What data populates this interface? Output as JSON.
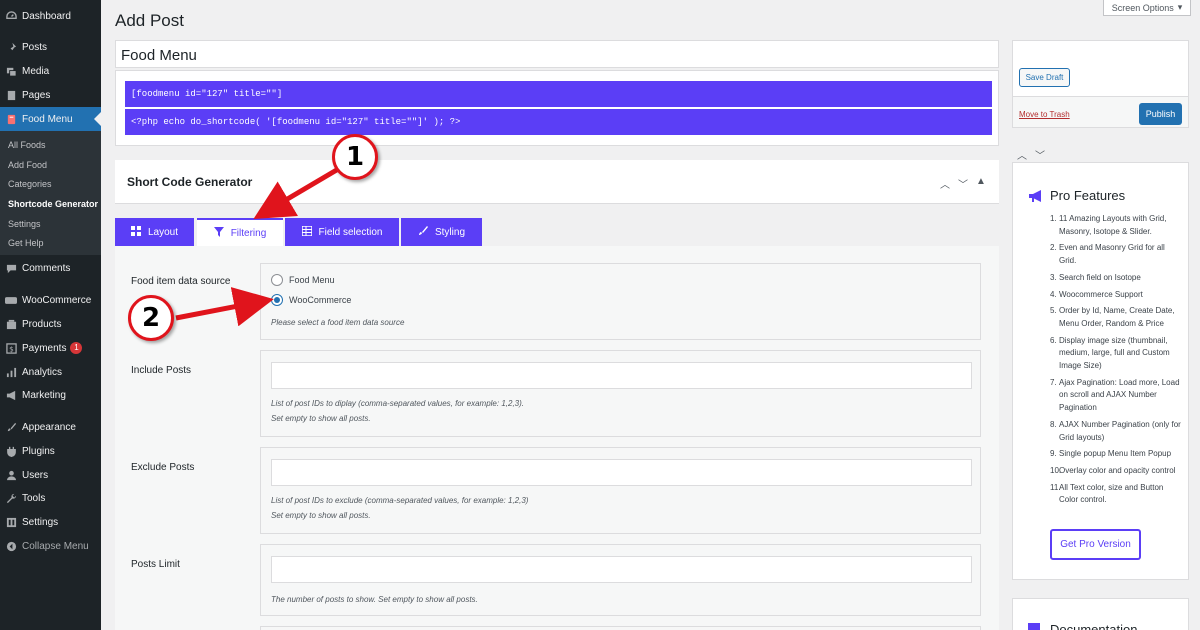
{
  "sidebar": {
    "items": [
      {
        "label": "Dashboard",
        "icon": "dashboard-icon"
      },
      {
        "label": "Posts",
        "icon": "pin-icon"
      },
      {
        "label": "Media",
        "icon": "media-icon"
      },
      {
        "label": "Pages",
        "icon": "page-icon"
      },
      {
        "label": "Food Menu",
        "icon": "food-menu-icon"
      },
      {
        "label": "Comments",
        "icon": "comment-icon"
      },
      {
        "label": "WooCommerce",
        "icon": "woocommerce-icon"
      },
      {
        "label": "Products",
        "icon": "products-icon"
      },
      {
        "label": "Payments",
        "icon": "payments-icon",
        "badge": "1"
      },
      {
        "label": "Analytics",
        "icon": "analytics-icon"
      },
      {
        "label": "Marketing",
        "icon": "megaphone-icon"
      },
      {
        "label": "Appearance",
        "icon": "brush-icon"
      },
      {
        "label": "Plugins",
        "icon": "plugin-icon"
      },
      {
        "label": "Users",
        "icon": "users-icon"
      },
      {
        "label": "Tools",
        "icon": "wrench-icon"
      },
      {
        "label": "Settings",
        "icon": "settings-icon"
      },
      {
        "label": "Collapse Menu",
        "icon": "collapse-icon"
      }
    ],
    "submenu": [
      "All Foods",
      "Add Food",
      "Categories",
      "Shortcode Generator",
      "Settings",
      "Get Help"
    ],
    "active_item": "Food Menu",
    "current_submenu": "Shortcode Generator"
  },
  "header": {
    "page_title": "Add Post",
    "screen_options": "Screen Options"
  },
  "post": {
    "title_value": "Food Menu",
    "shortcode": "[foodmenu id=\"127\" title=\"\"]",
    "php_code": "<?php echo do_shortcode( '[foodmenu id=\"127\" title=\"\"]' ); ?>"
  },
  "generator": {
    "title": "Short Code Generator",
    "tabs": [
      {
        "label": "Layout",
        "icon": "grid-icon"
      },
      {
        "label": "Filtering",
        "icon": "filter-icon",
        "active": true
      },
      {
        "label": "Field selection",
        "icon": "table-icon"
      },
      {
        "label": "Styling",
        "icon": "brush-icon"
      }
    ],
    "fields": {
      "data_source": {
        "label": "Food item data source",
        "options": [
          "Food Menu",
          "WooCommerce"
        ],
        "selected": "WooCommerce",
        "help": "Please select a food item data source"
      },
      "include_posts": {
        "label": "Include Posts",
        "value": "",
        "help_line1": "List of post IDs to diplay (comma-separated values, for example: 1,2,3).",
        "help_line2": "Set empty to show all posts."
      },
      "exclude_posts": {
        "label": "Exclude Posts",
        "value": "",
        "help_line1": "List of post IDs to exclude (comma-separated values, for example: 1,2,3)",
        "help_line2": "Set empty to show all posts."
      },
      "posts_limit": {
        "label": "Posts Limit",
        "value": "",
        "help": "The number of posts to show. Set empty to show all posts."
      }
    }
  },
  "publish": {
    "save_draft": "Save Draft",
    "move_to_trash": "Move to Trash",
    "publish": "Publish"
  },
  "pro": {
    "title": "Pro Features",
    "features": [
      "11 Amazing Layouts with Grid, Masonry, Isotope & Slider.",
      "Even and Masonry Grid for all Grid.",
      "Search field on Isotope",
      "Woocommerce Support",
      "Order by Id, Name, Create Date, Menu Order, Random & Price",
      "Display image size (thumbnail, medium, large, full and Custom Image Size)",
      "Ajax Pagination: Load more, Load on scroll and AJAX Number Pagination",
      "AJAX Number Pagination (only for Grid layouts)",
      "Single popup Menu Item Popup",
      "Overlay color and opacity control",
      "All Text color, size and Button Color control."
    ],
    "button": "Get Pro Version"
  },
  "documentation": {
    "title": "Documentation"
  },
  "annotations": {
    "callout_1": "1",
    "callout_2": "2"
  },
  "colors": {
    "accent": "#5b3ef6",
    "wp_blue": "#2271b1",
    "sidebar_bg": "#1d2327",
    "annotation_red": "#e0141c"
  }
}
